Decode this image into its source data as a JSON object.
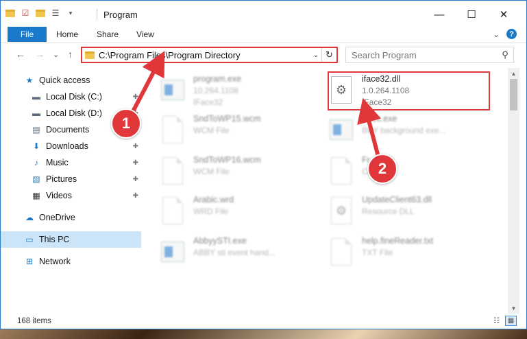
{
  "window": {
    "title": "Program",
    "min_glyph": "—",
    "max_glyph": "☐",
    "close_glyph": "✕"
  },
  "ribbon": {
    "file_tab": "File",
    "tabs": [
      "Home",
      "Share",
      "View"
    ],
    "expand_glyph": "⌄",
    "help_glyph": "?"
  },
  "nav": {
    "back_glyph": "←",
    "forward_glyph": "→",
    "recent_glyph": "⌄",
    "up_glyph": "↑",
    "address": "C:\\Program Files\\Program Directory",
    "address_drop_glyph": "⌄",
    "refresh_glyph": "↻",
    "search_placeholder": "Search Program",
    "search_glyph": "⚲"
  },
  "sidebar": {
    "items": [
      {
        "label": "Quick access",
        "icon": "star-icon",
        "glyph": "★",
        "color": "#1979ca",
        "pinned": false
      },
      {
        "label": "Local Disk (C:)",
        "icon": "drive-icon",
        "glyph": "▬",
        "color": "#5a6a7a",
        "pinned": true
      },
      {
        "label": "Local Disk (D:)",
        "icon": "drive-icon",
        "glyph": "▬",
        "color": "#5a6a7a",
        "pinned": true
      },
      {
        "label": "Documents",
        "icon": "document-icon",
        "glyph": "▤",
        "color": "#5a6a7a",
        "pinned": true
      },
      {
        "label": "Downloads",
        "icon": "download-arrow-icon",
        "glyph": "⬇",
        "color": "#1979ca",
        "pinned": true
      },
      {
        "label": "Music",
        "icon": "music-note-icon",
        "glyph": "♪",
        "color": "#1979ca",
        "pinned": true
      },
      {
        "label": "Pictures",
        "icon": "picture-icon",
        "glyph": "▧",
        "color": "#2e7bb5",
        "pinned": true
      },
      {
        "label": "Videos",
        "icon": "film-icon",
        "glyph": "▦",
        "color": "#333333",
        "pinned": true
      },
      {
        "label": "OneDrive",
        "icon": "cloud-icon",
        "glyph": "☁",
        "color": "#1979ca",
        "pinned": false
      },
      {
        "label": "This PC",
        "icon": "computer-icon",
        "glyph": "▭",
        "color": "#1979ca",
        "pinned": false,
        "selected": true
      },
      {
        "label": "Network",
        "icon": "network-icon",
        "glyph": "⊞",
        "color": "#1979ca",
        "pinned": false
      }
    ],
    "pin_glyph": "✚"
  },
  "files": [
    {
      "name": "program.exe",
      "sub1": "10.264.1108",
      "sub2": "IFace32",
      "kind": "app",
      "blurred": true
    },
    {
      "name": "iface32.dll",
      "sub1": "1.0.264.1108",
      "sub2": "IFace32",
      "kind": "gear",
      "blurred": false,
      "highlighted": true
    },
    {
      "name": "SndToWP15.wcm",
      "sub1": "WCM File",
      "sub2": "",
      "kind": "doc",
      "blurred": true
    },
    {
      "name": "Exec.exe",
      "sub1": "BBY background exe...",
      "sub2": "",
      "kind": "app",
      "blurred": true
    },
    {
      "name": "SndToWP16.wcm",
      "sub1": "WCM File",
      "sub2": "",
      "kind": "doc",
      "blurred": true
    },
    {
      "name": "Fr...d.cjk",
      "sub1": "C...",
      "sub2": "",
      "kind": "doc",
      "blurred": true
    },
    {
      "name": "Arabic.wrd",
      "sub1": "WRD File",
      "sub2": "",
      "kind": "doc",
      "blurred": true
    },
    {
      "name": "UpdateClient63.dll",
      "sub1": "Resource DLL",
      "sub2": "",
      "kind": "gear",
      "blurred": true
    },
    {
      "name": "AbbyySTI.exe",
      "sub1": "ABBY sti event hand...",
      "sub2": "",
      "kind": "app",
      "blurred": true
    },
    {
      "name": "help.fineReader.txt",
      "sub1": "TXT File",
      "sub2": "",
      "kind": "doc",
      "blurred": true
    }
  ],
  "status": {
    "item_count": "168 items"
  },
  "callouts": {
    "badge1": "1",
    "badge2": "2",
    "color": "#e0373b"
  },
  "colors": {
    "accent": "#1979ca",
    "selection": "#cce4f7",
    "highlight": "#e0373b"
  }
}
